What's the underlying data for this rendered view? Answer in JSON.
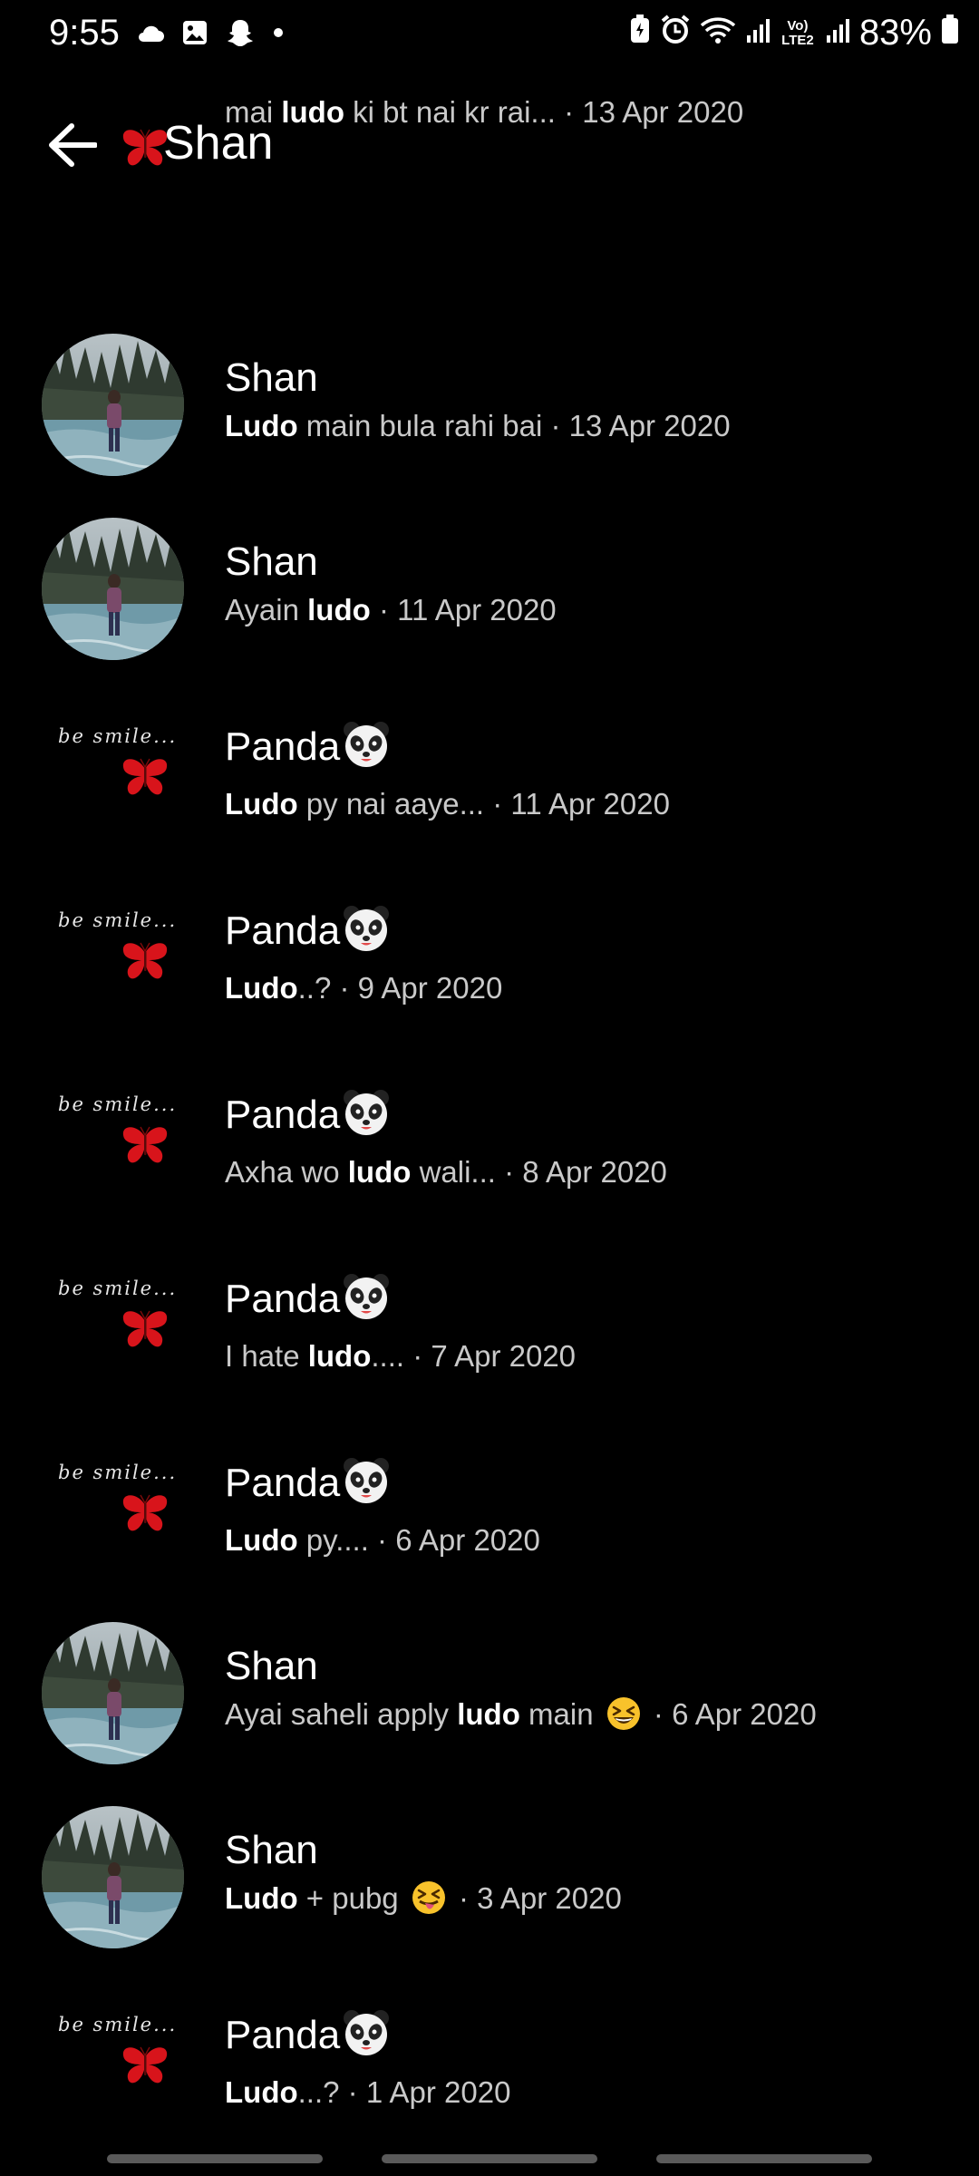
{
  "status_bar": {
    "time": "9:55",
    "battery": "83%",
    "network_label": "Vo) LTE2",
    "icons": [
      "cloud-icon",
      "gallery-icon",
      "snapchat-icon",
      "dot-icon",
      "battery-saver-icon",
      "alarm-icon",
      "wifi-icon",
      "signal-icon",
      "signal-icon",
      "battery-icon"
    ]
  },
  "header": {
    "title": "Shan",
    "back_icon": "arrow-left-icon"
  },
  "results": [
    {
      "avatar": "smile",
      "name": "",
      "pre": "mai ",
      "bold": "ludo",
      "post": " ki bt nai kr rai...",
      "emoji": "",
      "date": " · 13 Apr 2020"
    },
    {
      "avatar": "photo",
      "name": "Shan",
      "pre": "",
      "bold": "Ludo",
      "post": " main bula rahi bai",
      "emoji": "",
      "date": " · 13 Apr 2020"
    },
    {
      "avatar": "photo",
      "name": "Shan",
      "pre": "Ayain ",
      "bold": "ludo",
      "post": "",
      "emoji": "",
      "date": " · 11 Apr 2020"
    },
    {
      "avatar": "smile",
      "name": "Panda",
      "pre": "",
      "bold": "Ludo",
      "post": " py nai aaye...",
      "emoji": "",
      "date": " · 11 Apr 2020"
    },
    {
      "avatar": "smile",
      "name": "Panda",
      "pre": "",
      "bold": "Ludo",
      "post": "..?",
      "emoji": "",
      "date": " · 9 Apr 2020"
    },
    {
      "avatar": "smile",
      "name": "Panda",
      "pre": "Axha wo ",
      "bold": "ludo",
      "post": " wali...",
      "emoji": "",
      "date": " · 8 Apr 2020"
    },
    {
      "avatar": "smile",
      "name": "Panda",
      "pre": "I hate ",
      "bold": "ludo",
      "post": "....",
      "emoji": "",
      "date": " · 7 Apr 2020"
    },
    {
      "avatar": "smile",
      "name": "Panda",
      "pre": "",
      "bold": "Ludo",
      "post": " py....",
      "emoji": "",
      "date": " · 6 Apr 2020"
    },
    {
      "avatar": "photo",
      "name": "Shan",
      "pre": "Ayai saheli apply ",
      "bold": "ludo",
      "post": " main ",
      "emoji": "grinning-squint-emoji",
      "date": " · 6 Apr 2020"
    },
    {
      "avatar": "photo",
      "name": "Shan",
      "pre": "",
      "bold": "Ludo",
      "post": " + pubg ",
      "emoji": "tongue-wink-emoji",
      "date": " · 3 Apr 2020"
    },
    {
      "avatar": "smile",
      "name": "Panda",
      "pre": "",
      "bold": "Ludo",
      "post": "...?",
      "emoji": "",
      "date": " · 1 Apr 2020"
    }
  ],
  "avatar_caption": "be  smile...",
  "name_emoji": "panda-emoji",
  "colors": {
    "background": "#000000",
    "text_primary": "#ffffff",
    "text_secondary": "#c9c9c9",
    "butterfly": "#d8141b"
  }
}
